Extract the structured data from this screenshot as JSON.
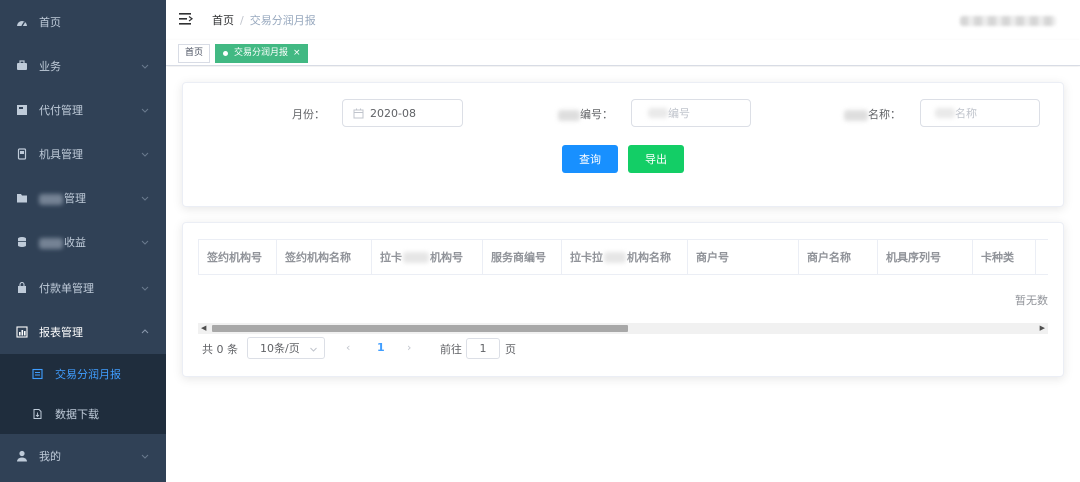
{
  "sidebar": {
    "items": [
      {
        "label": "首页",
        "icon": "dashboard-icon",
        "has_arrow": false
      },
      {
        "label": "业务",
        "icon": "briefcase-icon",
        "has_arrow": true
      },
      {
        "label": "代付管理",
        "icon": "document-icon",
        "has_arrow": true
      },
      {
        "label": "机具管理",
        "icon": "pos-terminal-icon",
        "has_arrow": true
      },
      {
        "label": "管理",
        "icon": "folder-icon",
        "has_arrow": true
      },
      {
        "label": "收益",
        "icon": "database-icon",
        "has_arrow": true
      },
      {
        "label": "付款单管理",
        "icon": "shopping-bag-icon",
        "has_arrow": true
      },
      {
        "label": "报表管理",
        "icon": "chart-icon",
        "has_arrow": true,
        "expanded": true
      }
    ],
    "subitems": [
      {
        "label": "交易分润月报",
        "icon": "report-icon",
        "active": true
      },
      {
        "label": "数据下载",
        "icon": "download-file-icon",
        "active": false
      }
    ],
    "last_item": {
      "label": "我的",
      "icon": "user-icon"
    }
  },
  "navbar": {
    "breadcrumb_home": "首页",
    "breadcrumb_separator": "/",
    "breadcrumb_current": "交易分润月报"
  },
  "tags": {
    "home": "首页",
    "active": "交易分润月报",
    "close": "×"
  },
  "search": {
    "month_label": "月份：",
    "month_value": "2020-08",
    "code_label": "编号：",
    "code_placeholder": "编号",
    "name_label": "名称：",
    "name_placeholder": "名称",
    "query_button": "查询",
    "export_button": "导出"
  },
  "table": {
    "columns": [
      "签约机构号",
      "签约机构名称",
      "拉卡",
      "机构号",
      "服务商编号",
      "拉卡拉",
      "机构名称",
      "商户号",
      "商户名称",
      "机具序列号",
      "卡种类"
    ],
    "empty_text": "暂无数"
  },
  "pagination": {
    "total": "共 0 条",
    "page_size": "10条/页",
    "prev": "‹",
    "current": "1",
    "next": "›",
    "goto_label": "前往",
    "goto_value": "1",
    "page_suffix": "页"
  },
  "colors": {
    "sidebar_bg": "#304156",
    "submenu_bg": "#1f2d3d",
    "menu_text": "#bfcbd9",
    "active_text": "#409eff",
    "tag_active": "#42b983",
    "primary": "#1890ff",
    "success": "#13ce66"
  }
}
